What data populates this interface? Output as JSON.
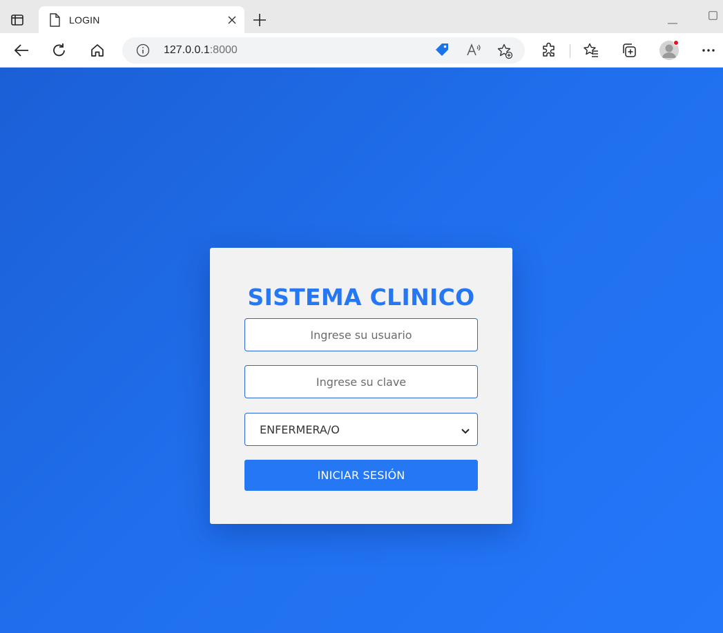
{
  "browser": {
    "tab": {
      "title": "LOGIN"
    },
    "address": {
      "host": "127.0.0.1",
      "port": ":8000"
    },
    "icons": [
      "tab-actions-icon",
      "page-icon",
      "close-icon",
      "new-tab-icon",
      "back-icon",
      "refresh-icon",
      "home-icon",
      "info-icon",
      "coupon-tag-icon",
      "read-aloud-icon",
      "add-favorite-icon",
      "extensions-icon",
      "favorites-icon",
      "collections-icon",
      "profile-avatar",
      "more-options-icon"
    ]
  },
  "login": {
    "title": "SISTEMA CLINICO",
    "username_placeholder": "Ingrese su usuario",
    "password_placeholder": "Ingrese su clave",
    "role_selected": "ENFERMERA/O",
    "submit_label": "INICIAR SESIÓN"
  },
  "colors": {
    "page_gradient_start": "#1b5fd6",
    "page_gradient_end": "#2577fa",
    "card_background": "#f2f2f2",
    "accent": "#2677f3",
    "input_border": "#2a67d6"
  }
}
